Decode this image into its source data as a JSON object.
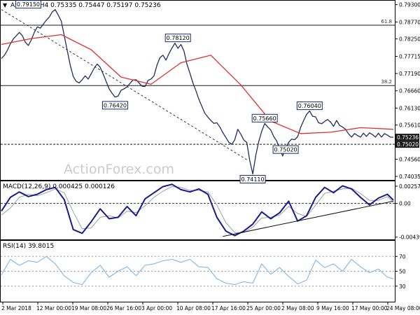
{
  "colors": {
    "price": "#1f2f5f",
    "ma": "#e03030",
    "macd": "#1a1a8c",
    "signal": "#9aa0a8",
    "rsi": "#7bb8e8",
    "hline": "#1a1a1a",
    "watermark": "#c9ccd3",
    "label_border": "#1a2a6c",
    "current_bg": "#1a1a1a",
    "current_fg": "#ffffff"
  },
  "chart_data": [
    {
      "type": "line",
      "panel": "price",
      "header": "AUDUSD,H4  0.75335 0.75447 0.75197 0.75236",
      "watermark": "ActionForex.com",
      "ylim": [
        0.7395,
        0.794
      ],
      "y_ticks": [
        "0.79300",
        "0.78770",
        "0.78250",
        "0.77715",
        "0.77190",
        "0.76660",
        "0.76130",
        "0.75610",
        "0.74560",
        "0.74035"
      ],
      "x_ticks": [
        "2 Mar 2018",
        "12 Mar 00:00",
        "19 Mar 08:00",
        "26 Mar 16:00",
        "3 Apr 00:00",
        "10 Apr 08:00",
        "17 Apr 16:00",
        "25 Apr 00:00",
        "2 May 08:00",
        "9 May 16:00",
        "17 May 00:00",
        "24 May 08:00"
      ],
      "series": [
        {
          "role": "price",
          "x": [
            0,
            2,
            4,
            6,
            8,
            10,
            12,
            14,
            16,
            18,
            20,
            22,
            24,
            26,
            28,
            30,
            32,
            34,
            36,
            38,
            40,
            42,
            44,
            46,
            48,
            50,
            52,
            54,
            56,
            58,
            60,
            62,
            64,
            66,
            68,
            70,
            72,
            74,
            76,
            78,
            80,
            82,
            84,
            86,
            88,
            90,
            92,
            94,
            96,
            98,
            100,
            102,
            104,
            106,
            108,
            110,
            112,
            114,
            116,
            118,
            120,
            122,
            124,
            126,
            128,
            130,
            132,
            134,
            136,
            138,
            140,
            142,
            144,
            146,
            148,
            150,
            152,
            154,
            156,
            158,
            160,
            162,
            164,
            166,
            168,
            170,
            172,
            174,
            176,
            178,
            180,
            182,
            184,
            186,
            188,
            190,
            192,
            194,
            196,
            198,
            200,
            202,
            204,
            206,
            208,
            210,
            212,
            214,
            216,
            218,
            220,
            222,
            224,
            226,
            228,
            230,
            232,
            234,
            236,
            238,
            240,
            242,
            244,
            246,
            248,
            250,
            252,
            254,
            256,
            258,
            260,
            262
          ],
          "y": [
            0.7765,
            0.7775,
            0.779,
            0.781,
            0.7825,
            0.7835,
            0.7845,
            0.7835,
            0.7815,
            0.7805,
            0.7822,
            0.7845,
            0.7862,
            0.7858,
            0.787,
            0.7882,
            0.7892,
            0.7908,
            0.7915,
            0.7898,
            0.788,
            0.7835,
            0.779,
            0.7745,
            0.771,
            0.7695,
            0.769,
            0.77,
            0.7712,
            0.7702,
            0.7718,
            0.7735,
            0.7748,
            0.7738,
            0.7718,
            0.7695,
            0.7672,
            0.7658,
            0.7647,
            0.765,
            0.7668,
            0.7672,
            0.7678,
            0.7689,
            0.7699,
            0.77,
            0.769,
            0.768,
            0.7679,
            0.7698,
            0.7702,
            0.7712,
            0.7745,
            0.7768,
            0.7775,
            0.776,
            0.778,
            0.7797,
            0.7812,
            0.7796,
            0.7808,
            0.7788,
            0.7748,
            0.772,
            0.769,
            0.7666,
            0.764,
            0.7618,
            0.7597,
            0.7585,
            0.7575,
            0.7566,
            0.7568,
            0.7555,
            0.7538,
            0.7523,
            0.7508,
            0.7502,
            0.7516,
            0.7548,
            0.7533,
            0.7515,
            0.7508,
            0.7452,
            0.7411,
            0.7468,
            0.751,
            0.7542,
            0.7566,
            0.7555,
            0.7546,
            0.7526,
            0.7512,
            0.7488,
            0.7466,
            0.749,
            0.7508,
            0.7518,
            0.7516,
            0.7525,
            0.7554,
            0.7575,
            0.7594,
            0.7604,
            0.7588,
            0.7586,
            0.7568,
            0.7565,
            0.7572,
            0.7578,
            0.757,
            0.7557,
            0.7575,
            0.756,
            0.7555,
            0.7548,
            0.7534,
            0.7524,
            0.7535,
            0.7529,
            0.7524,
            0.7536,
            0.7526,
            0.7537,
            0.7532,
            0.7524,
            0.7536,
            0.7524,
            0.7535,
            0.753,
            0.7524,
            0.75236
          ]
        },
        {
          "role": "moving-average",
          "x": [
            0,
            20,
            40,
            60,
            80,
            100,
            120,
            140,
            160,
            180,
            200,
            220,
            240,
            262
          ],
          "y": [
            0.7808,
            0.7826,
            0.7838,
            0.7792,
            0.7708,
            0.7686,
            0.7752,
            0.7775,
            0.7684,
            0.7573,
            0.7535,
            0.7539,
            0.7553,
            0.7548
          ]
        }
      ],
      "horizontal_lines": [
        {
          "label": "61.8",
          "y": 0.7867
        },
        {
          "label": "38.2",
          "y": 0.7682
        },
        {
          "label": "",
          "y": 0.7502
        }
      ],
      "trendline": {
        "x": [
          0,
          165
        ],
        "y": [
          0.7915,
          0.7452
        ]
      },
      "annotations": [
        {
          "label": "0.79150",
          "x": 18,
          "y": 0.7915
        },
        {
          "label": "0.78120",
          "x": 118,
          "y": 0.7812
        },
        {
          "label": "0.76420",
          "x": 76,
          "y": 0.7642
        },
        {
          "label": "0.75660",
          "x": 176,
          "y": 0.7566
        },
        {
          "label": "0.76040",
          "x": 206,
          "y": 0.7604
        },
        {
          "label": "0.75020",
          "x": 190,
          "y": 0.7502
        },
        {
          "label": "0.74110",
          "x": 168,
          "y": 0.7411
        }
      ],
      "current_price_labels": [
        "0.75236",
        "0.75020"
      ],
      "grid": false
    },
    {
      "type": "line",
      "panel": "macd",
      "header": "MACD(12,26,9) 0.000425 0.000126",
      "y_ticks": [
        "0.00257",
        "0.00",
        "-0.004392"
      ],
      "ylim": [
        -0.0046,
        0.0028
      ],
      "series": [
        {
          "role": "macd",
          "x": [
            0,
            6,
            12,
            18,
            24,
            30,
            36,
            42,
            48,
            54,
            60,
            66,
            72,
            78,
            84,
            90,
            96,
            102,
            108,
            114,
            120,
            126,
            132,
            138,
            144,
            150,
            156,
            162,
            168,
            174,
            180,
            186,
            192,
            198,
            204,
            210,
            216,
            222,
            228,
            234,
            240,
            246,
            252,
            258,
            262
          ],
          "y": [
            -0.001,
            0.0008,
            0.0015,
            0.0009,
            0.0012,
            0.0018,
            0.0021,
            0.0005,
            -0.0034,
            -0.0039,
            -0.0024,
            -0.0007,
            -0.002,
            -0.0018,
            -0.0004,
            -0.0016,
            0.0006,
            0.0014,
            0.0022,
            0.0025,
            0.0018,
            0.0015,
            0.0019,
            0.0012,
            -0.0018,
            -0.0036,
            -0.0042,
            -0.0036,
            -0.0027,
            -0.0011,
            -0.002,
            -0.0012,
            0.0003,
            -0.0023,
            -0.0016,
            0.0008,
            0.0021,
            0.0014,
            0.0023,
            0.0019,
            0.0008,
            -0.0002,
            0.0007,
            0.0012,
            0.000425
          ]
        },
        {
          "role": "signal",
          "x": [
            0,
            6,
            12,
            18,
            24,
            30,
            36,
            42,
            48,
            54,
            60,
            66,
            72,
            78,
            84,
            90,
            96,
            102,
            108,
            114,
            120,
            126,
            132,
            138,
            144,
            150,
            156,
            162,
            168,
            174,
            180,
            186,
            192,
            198,
            204,
            210,
            216,
            222,
            228,
            234,
            240,
            246,
            252,
            258,
            262
          ],
          "y": [
            -0.0015,
            -0.0006,
            0.0008,
            0.0012,
            0.001,
            0.0014,
            0.0019,
            0.0014,
            -0.0011,
            -0.0033,
            -0.0032,
            -0.0018,
            -0.0016,
            -0.0019,
            -0.001,
            -0.0012,
            -0.0003,
            0.0008,
            0.0016,
            0.0022,
            0.0021,
            0.0017,
            0.0017,
            0.0015,
            -0.0002,
            -0.0025,
            -0.0038,
            -0.0038,
            -0.0031,
            -0.0019,
            -0.0018,
            -0.0015,
            -0.0004,
            -0.0013,
            -0.0017,
            -0.0002,
            0.0013,
            0.0016,
            0.0019,
            0.002,
            0.0013,
            0.0004,
            0.0004,
            0.0009,
            0.000126
          ]
        }
      ],
      "zero_line": 0,
      "trendline": {
        "x": [
          148,
          262
        ],
        "y": [
          -0.0043,
          0.0003
        ]
      }
    },
    {
      "type": "line",
      "panel": "rsi",
      "header": "RSI(14) 39.8015",
      "y_ticks": [
        "70",
        "50",
        "30"
      ],
      "ylim": [
        10,
        90
      ],
      "series": [
        {
          "role": "rsi",
          "x": [
            0,
            6,
            12,
            18,
            24,
            30,
            36,
            42,
            48,
            54,
            60,
            66,
            72,
            78,
            84,
            90,
            96,
            102,
            108,
            114,
            120,
            126,
            132,
            138,
            144,
            150,
            156,
            162,
            168,
            174,
            180,
            186,
            192,
            198,
            204,
            210,
            216,
            222,
            228,
            234,
            240,
            246,
            252,
            258,
            262
          ],
          "y": [
            45,
            66,
            58,
            64,
            62,
            70,
            60,
            44,
            35,
            32,
            48,
            58,
            42,
            50,
            56,
            44,
            58,
            60,
            64,
            66,
            62,
            66,
            56,
            55,
            40,
            34,
            32,
            36,
            34,
            60,
            46,
            55,
            43,
            33,
            38,
            65,
            55,
            60,
            50,
            66,
            56,
            48,
            53,
            42,
            39.8015
          ]
        }
      ],
      "levels": [
        70,
        50,
        30
      ]
    }
  ]
}
